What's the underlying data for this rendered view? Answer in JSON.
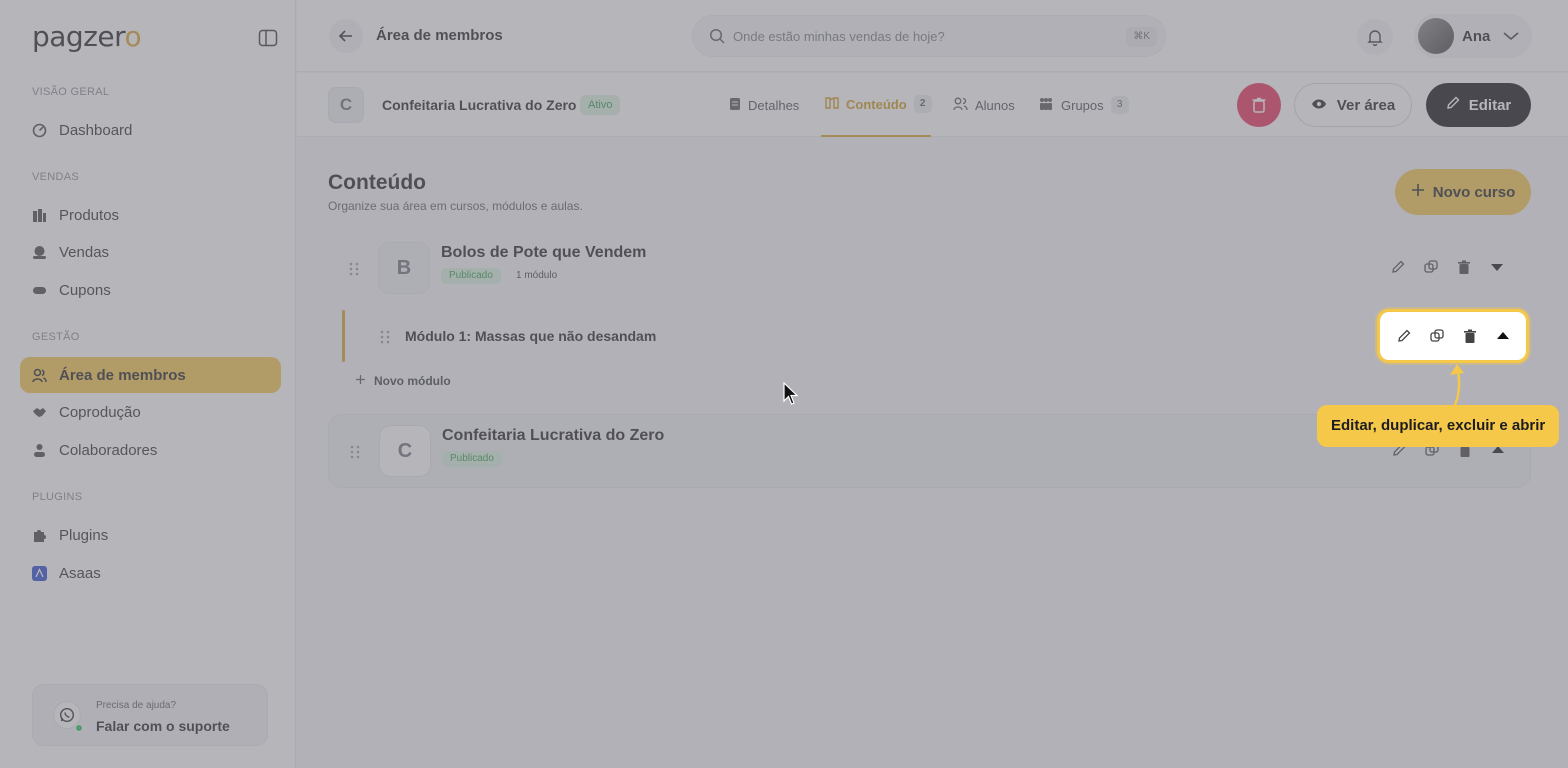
{
  "sidebar": {
    "logo": "pagzer",
    "logo_accent": "o",
    "sections": {
      "overview": "VISÃO GERAL",
      "sales": "VENDAS",
      "management": "GESTÃO",
      "plugins": "PLUGINS"
    },
    "items": {
      "dashboard": "Dashboard",
      "products": "Produtos",
      "sales": "Vendas",
      "coupons": "Cupons",
      "members": "Área de membros",
      "coproduction": "Coprodução",
      "collaborators": "Colaboradores",
      "plugins": "Plugins",
      "asaas": "Asaas"
    },
    "support": {
      "small": "Precisa de ajuda?",
      "big": "Falar com o suporte"
    }
  },
  "topbar": {
    "title": "Área de membros",
    "search_placeholder": "Onde estão minhas vendas de hoje?",
    "shortcut": "⌘K",
    "user_name": "Ana"
  },
  "area": {
    "avatar_letter": "C",
    "name": "Confeitaria Lucrativa do Zero",
    "status": "Ativo",
    "tabs": [
      {
        "label": "Detalhes",
        "count": ""
      },
      {
        "label": "Conteúdo",
        "count": "2"
      },
      {
        "label": "Alunos",
        "count": ""
      },
      {
        "label": "Grupos",
        "count": "3"
      }
    ],
    "view_label": "Ver área",
    "edit_label": "Editar"
  },
  "content": {
    "title": "Conteúdo",
    "subtitle": "Organize sua área em cursos, módulos e aulas.",
    "new_course": "Novo curso",
    "courses": [
      {
        "letter": "B",
        "name": "Bolos de Pote que Vendem",
        "status": "Publicado",
        "modules": "1 módulo"
      },
      {
        "letter": "C",
        "name": "Confeitaria Lucrativa do Zero",
        "status": "Publicado",
        "modules": ""
      }
    ],
    "module": {
      "name": "Módulo 1: Massas que não desandam"
    },
    "new_module": "Novo módulo"
  },
  "tour": {
    "tooltip": "Editar, duplicar, excluir e abrir"
  },
  "colors": {
    "accent": "#f5c84a",
    "danger": "#ec2c5a",
    "success": "#2f9d4b"
  }
}
